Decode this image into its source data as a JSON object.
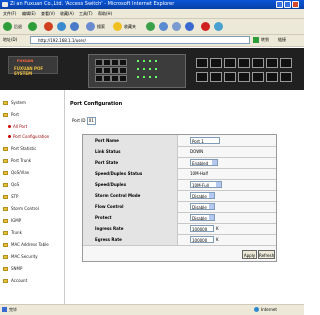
{
  "window": {
    "title": "Zi an Fuxuan Co.,Ltd. 'Access Switch' - Microsoft Internet Explorer"
  },
  "menu": [
    "文件(F)",
    "编辑(E)",
    "查看(V)",
    "收藏(A)",
    "工具(T)",
    "帮助(H)"
  ],
  "toolbar": {
    "back_label": "后退",
    "search_label": "搜索",
    "favorites_label": "收藏夹"
  },
  "address": {
    "label": "地址(D)",
    "url": "http://192.168.1.1/user/",
    "go_label": "转到",
    "links_label": "链接"
  },
  "banner": {
    "brand_top": "FUXUAN",
    "brand_name": "FUXUAN POF SYSTEM"
  },
  "sidebar": {
    "items": [
      {
        "label": "System",
        "type": "folder"
      },
      {
        "label": "Port",
        "type": "folder"
      },
      {
        "label": "All Port",
        "type": "sub"
      },
      {
        "label": "Port Configuration",
        "type": "sub"
      },
      {
        "label": "Port Statistic",
        "type": "folder"
      },
      {
        "label": "Port Trunk",
        "type": "folder"
      },
      {
        "label": "QoS/Vlan",
        "type": "folder"
      },
      {
        "label": "QoS",
        "type": "folder"
      },
      {
        "label": "STP",
        "type": "folder"
      },
      {
        "label": "Storm Control",
        "type": "folder"
      },
      {
        "label": "IGMP",
        "type": "folder"
      },
      {
        "label": "Trunk",
        "type": "folder"
      },
      {
        "label": "MAC Address Table",
        "type": "folder"
      },
      {
        "label": "MAC Security",
        "type": "folder"
      },
      {
        "label": "SNMP",
        "type": "folder"
      },
      {
        "label": "Account",
        "type": "folder"
      }
    ]
  },
  "main": {
    "title": "Port Configuration",
    "port_select_label": "Port ID",
    "port_select_value": "01",
    "form": {
      "port_name": {
        "label": "Port Name",
        "value": "Port 1"
      },
      "link_status": {
        "label": "Link Status",
        "value": "DOWN"
      },
      "port_state": {
        "label": "Port State",
        "value": "Enabled"
      },
      "speed_duplex_status": {
        "label": "Speed/Duplex Status",
        "value": "10M-Half"
      },
      "speed_duplex": {
        "label": "Speed/Duplex",
        "value": "10M-Full"
      },
      "storm_control_mode": {
        "label": "Storm Control Mode",
        "value": "Disable"
      },
      "flow_control": {
        "label": "Flow Control",
        "value": "Disable"
      },
      "protect": {
        "label": "Protect",
        "value": "Disable"
      },
      "ingress_rate": {
        "label": "Ingress Rate",
        "value": "100000",
        "unit": "K"
      },
      "egress_rate": {
        "label": "Egress Rate",
        "value": "100000",
        "unit": "K"
      }
    },
    "buttons": {
      "apply": "Apply",
      "refresh": "Refresh"
    }
  },
  "status": {
    "left": "完毕",
    "right": "Internet"
  }
}
